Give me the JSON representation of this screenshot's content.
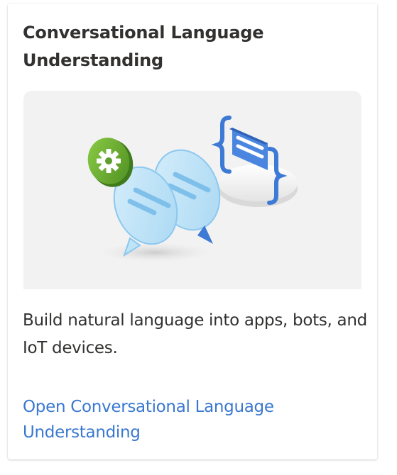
{
  "card": {
    "title": "Conversational Language Understanding",
    "description": "Build natural language into apps, bots, and IoT devices.",
    "link_label": "Open Conversational Language Understanding"
  },
  "illustration": {
    "icons": [
      "gear-icon",
      "chat-bubble-icon",
      "curly-braces-icon",
      "message-icon"
    ]
  },
  "colors": {
    "title": "#323130",
    "body_text": "#323130",
    "link": "#3a78d1",
    "illustration_bg": "#f2f2f2",
    "gear_green": "#6fb032",
    "bubble_light_blue": "#bfe3f7",
    "braces_blue": "#3d7ad6"
  }
}
